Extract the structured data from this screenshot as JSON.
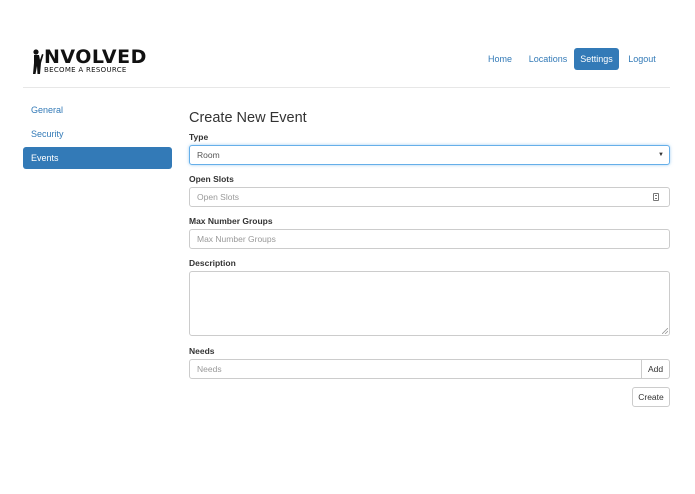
{
  "brand": {
    "name": "NVOLVED",
    "tagline": "BECOME A RESOURCE"
  },
  "nav": {
    "items": [
      {
        "label": "Home",
        "active": false
      },
      {
        "label": "Locations",
        "active": false
      },
      {
        "label": "Settings",
        "active": true
      },
      {
        "label": "Logout",
        "active": false
      }
    ]
  },
  "sidebar": {
    "items": [
      {
        "label": "General",
        "active": false
      },
      {
        "label": "Security",
        "active": false
      },
      {
        "label": "Events",
        "active": true
      }
    ]
  },
  "form": {
    "title": "Create New Event",
    "type": {
      "label": "Type",
      "value": "Room"
    },
    "open_slots": {
      "label": "Open Slots",
      "placeholder": "Open Slots"
    },
    "max_groups": {
      "label": "Max Number Groups",
      "placeholder": "Max Number Groups"
    },
    "description": {
      "label": "Description",
      "value": ""
    },
    "needs": {
      "label": "Needs",
      "placeholder": "Needs",
      "add_label": "Add"
    },
    "create_label": "Create"
  },
  "colors": {
    "accent": "#337ab7",
    "focus": "#66afe9"
  }
}
